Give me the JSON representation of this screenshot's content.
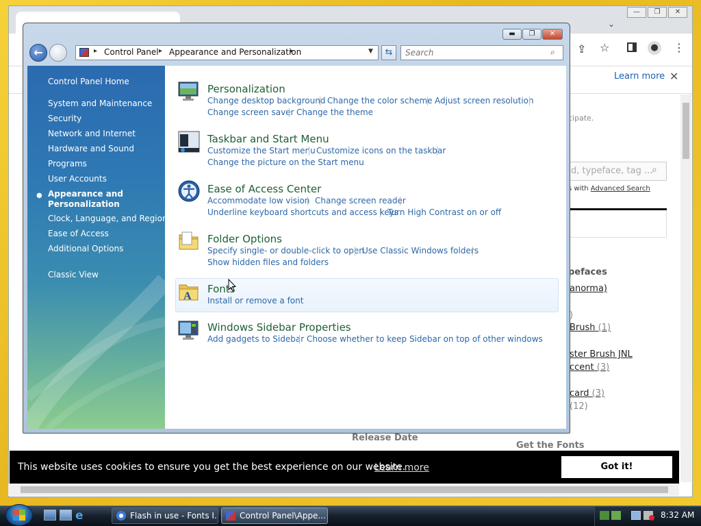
{
  "browser": {
    "info_learn_more": "Learn more",
    "web": {
      "participate_text": "cipate.",
      "search_placeholder": "d, typeface, tag ...",
      "advanced_prefix": "s with ",
      "advanced_link": "Advanced Search",
      "typefaces_heading": "peface s",
      "links": [
        {
          "text": "anorma)",
          "count": ""
        },
        {
          "text": "Brush",
          "count": "(1)"
        },
        {
          "text": "ster Brush JNL",
          "count": ""
        },
        {
          "text": "ccent",
          "count": "(3)"
        },
        {
          "text": "card",
          "count": "(3)"
        },
        {
          "text": "",
          "count": "(12)"
        }
      ],
      "small_paren": ")",
      "release_date": "Release Date",
      "get_fonts": "Get the Fonts"
    },
    "cookie": {
      "text": "This website uses cookies to ensure you get the best experience on our website.",
      "learn_more": "Learn more",
      "button": "Got it!"
    }
  },
  "control_panel": {
    "breadcrumb": [
      "Control Panel",
      "Appearance and Personalization"
    ],
    "search_placeholder": "Search",
    "left_pane": {
      "home": "Control Panel Home",
      "items": [
        "System and Maintenance",
        "Security",
        "Network and Internet",
        "Hardware and Sound",
        "Programs",
        "User Accounts",
        "Appearance and Personalization",
        "Clock, Language, and Region",
        "Ease of Access",
        "Additional Options"
      ],
      "active_index": 6,
      "classic_view": "Classic View"
    },
    "categories": [
      {
        "title": "Personalization",
        "icon": "personalization-icon",
        "links": [
          "Change desktop background",
          "Change the color scheme",
          "Adjust screen resolution",
          "Change screen saver",
          "Change the theme"
        ]
      },
      {
        "title": "Taskbar and Start Menu",
        "icon": "taskbar-icon",
        "links": [
          "Customize the Start menu",
          "Customize icons on the taskbar",
          "Change the picture on the Start menu"
        ]
      },
      {
        "title": "Ease of Access Center",
        "icon": "ease-of-access-icon",
        "links": [
          "Accommodate low vision",
          "Change screen reader",
          "Underline keyboard shortcuts and access keys",
          "Turn High Contrast on or off"
        ]
      },
      {
        "title": "Folder Options",
        "icon": "folder-options-icon",
        "links": [
          "Specify single- or double-click to open",
          "Use Classic Windows folders",
          "Show hidden files and folders"
        ]
      },
      {
        "title": "Fonts",
        "icon": "fonts-folder-icon",
        "links": [
          "Install or remove a font"
        ]
      },
      {
        "title": "Windows Sidebar Properties",
        "icon": "sidebar-icon",
        "links": [
          "Add gadgets to Sidebar",
          "Choose whether to keep Sidebar on top of other windows"
        ]
      }
    ]
  },
  "taskbar": {
    "buttons": [
      "Flash in use - Fonts I...",
      "Control Panel\\Appe..."
    ],
    "active_index": 1,
    "clock": "8:32 AM"
  }
}
